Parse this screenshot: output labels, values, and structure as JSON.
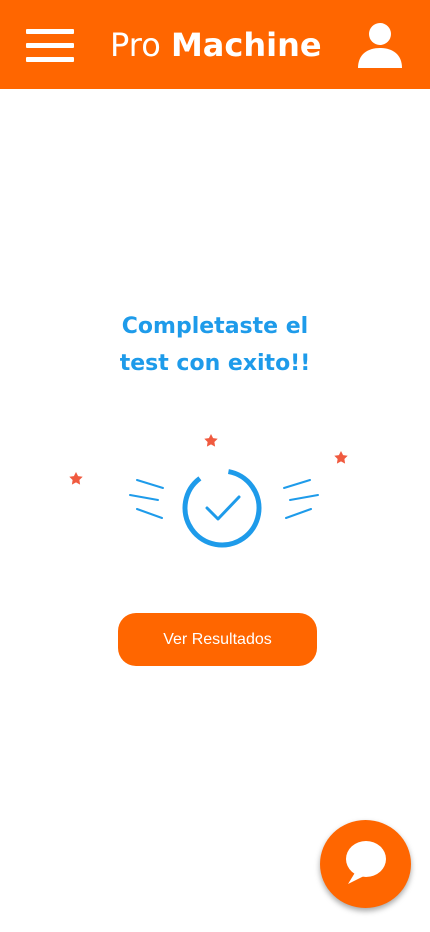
{
  "header": {
    "title_light": "Pro",
    "title_bold": "Machine",
    "menu_icon": "hamburger-menu-icon",
    "profile_icon": "user-profile-icon"
  },
  "main": {
    "success_line1": "Completaste el",
    "success_line2": "test con exito!!",
    "illustration_icon": "success-check-icon",
    "results_button_label": "Ver Resultados"
  },
  "chat": {
    "icon": "chat-bubble-icon"
  },
  "colors": {
    "primary": "#FF6600",
    "accent": "#1E9BEA",
    "star": "#F05A3F",
    "background": "#FFFFFF"
  }
}
